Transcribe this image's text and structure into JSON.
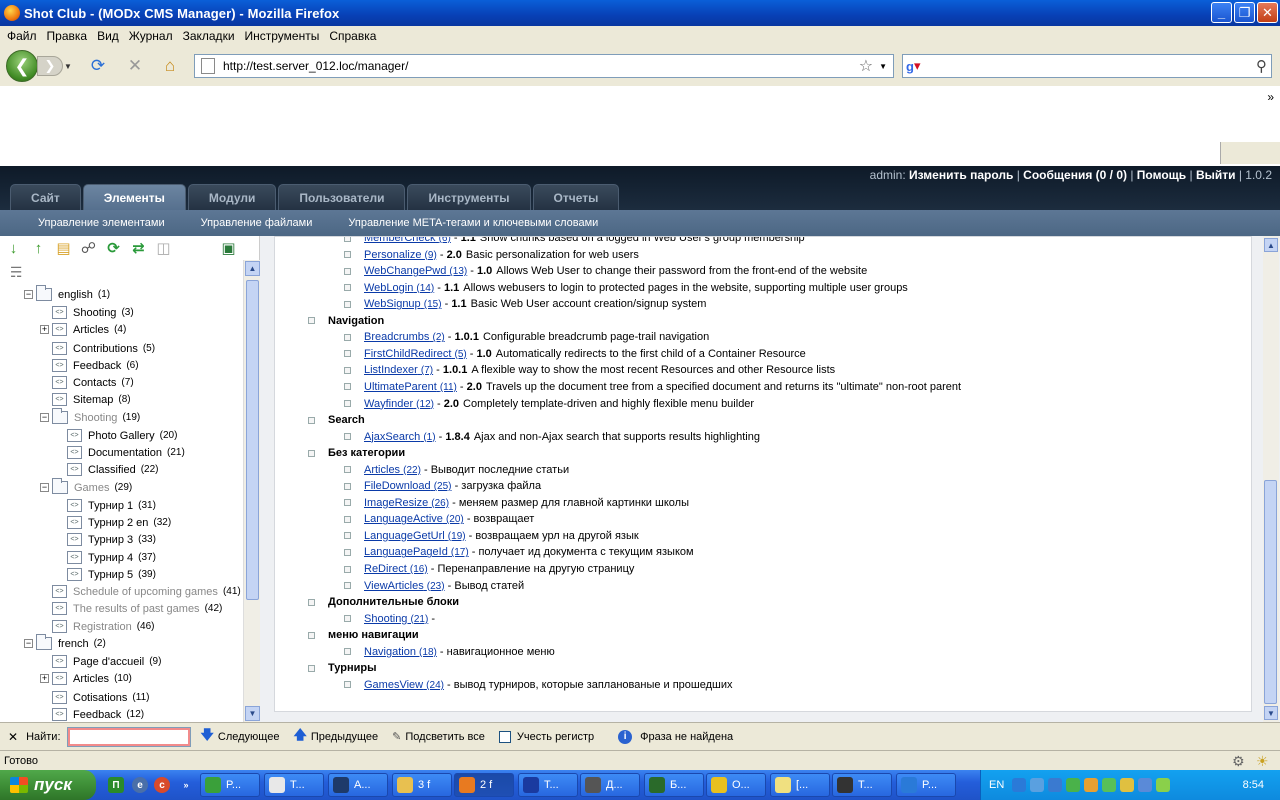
{
  "window": {
    "title": "Shot Club - (MODx CMS Manager) - Mozilla Firefox",
    "controls": [
      "_",
      "❐",
      "✕"
    ]
  },
  "menu": [
    "Файл",
    "Правка",
    "Вид",
    "Журнал",
    "Закладки",
    "Инструменты",
    "Справка"
  ],
  "nav": {
    "url": "http://test.server_012.loc/manager/",
    "search_value": ""
  },
  "modx": {
    "user_prefix": "admin:",
    "links": [
      "Изменить пароль",
      "Сообщения (0 / 0)",
      "Помощь",
      "Выйти"
    ],
    "version": "1.0.2",
    "tabs": [
      "Сайт",
      "Элементы",
      "Модули",
      "Пользователи",
      "Инструменты",
      "Отчеты"
    ],
    "active_tab": "Элементы",
    "subnav": [
      "Управление элементами",
      "Управление файлами",
      "Управление META-тегами и ключевыми словами"
    ]
  },
  "tree": [
    {
      "label": "english",
      "count": "(1)",
      "level": 0,
      "toggle": "−",
      "folder": true,
      "grey": false
    },
    {
      "label": "Shooting",
      "count": "(3)",
      "level": 1,
      "toggle": "",
      "folder": false,
      "grey": false
    },
    {
      "label": "Articles",
      "count": "(4)",
      "level": 1,
      "toggle": "+",
      "folder": false,
      "grey": false
    },
    {
      "label": "Contributions",
      "count": "(5)",
      "level": 1,
      "toggle": "",
      "folder": false,
      "grey": false
    },
    {
      "label": "Feedback",
      "count": "(6)",
      "level": 1,
      "toggle": "",
      "folder": false,
      "grey": false
    },
    {
      "label": "Contacts",
      "count": "(7)",
      "level": 1,
      "toggle": "",
      "folder": false,
      "grey": false
    },
    {
      "label": "Sitemap",
      "count": "(8)",
      "level": 1,
      "toggle": "",
      "folder": false,
      "grey": false
    },
    {
      "label": "Shooting",
      "count": "(19)",
      "level": 1,
      "toggle": "−",
      "folder": true,
      "grey": true
    },
    {
      "label": "Photo Gallery",
      "count": "(20)",
      "level": 2,
      "toggle": "",
      "folder": false,
      "grey": false
    },
    {
      "label": "Documentation",
      "count": "(21)",
      "level": 2,
      "toggle": "",
      "folder": false,
      "grey": false
    },
    {
      "label": "Classified",
      "count": "(22)",
      "level": 2,
      "toggle": "",
      "folder": false,
      "grey": false
    },
    {
      "label": "Games",
      "count": "(29)",
      "level": 1,
      "toggle": "−",
      "folder": true,
      "grey": true
    },
    {
      "label": "Турнир 1",
      "count": "(31)",
      "level": 2,
      "toggle": "",
      "folder": false,
      "grey": false
    },
    {
      "label": "Турнир 2 en",
      "count": "(32)",
      "level": 2,
      "toggle": "",
      "folder": false,
      "grey": false
    },
    {
      "label": "Турнир 3",
      "count": "(33)",
      "level": 2,
      "toggle": "",
      "folder": false,
      "grey": false
    },
    {
      "label": "Турнир 4",
      "count": "(37)",
      "level": 2,
      "toggle": "",
      "folder": false,
      "grey": false
    },
    {
      "label": "Турнир 5",
      "count": "(39)",
      "level": 2,
      "toggle": "",
      "folder": false,
      "grey": false
    },
    {
      "label": "Schedule of upcoming games",
      "count": "(41)",
      "level": 1,
      "toggle": "",
      "folder": false,
      "grey": true
    },
    {
      "label": "The results of past games",
      "count": "(42)",
      "level": 1,
      "toggle": "",
      "folder": false,
      "grey": true
    },
    {
      "label": "Registration",
      "count": "(46)",
      "level": 1,
      "toggle": "",
      "folder": false,
      "grey": true
    },
    {
      "label": "french",
      "count": "(2)",
      "level": 0,
      "toggle": "−",
      "folder": true,
      "grey": false
    },
    {
      "label": "Page d'accueil",
      "count": "(9)",
      "level": 1,
      "toggle": "",
      "folder": false,
      "grey": false
    },
    {
      "label": "Articles",
      "count": "(10)",
      "level": 1,
      "toggle": "+",
      "folder": false,
      "grey": false
    },
    {
      "label": "Cotisations",
      "count": "(11)",
      "level": 1,
      "toggle": "",
      "folder": false,
      "grey": false
    },
    {
      "label": "Feedback",
      "count": "(12)",
      "level": 1,
      "toggle": "",
      "folder": false,
      "grey": false
    }
  ],
  "content": [
    {
      "type": "item",
      "name": "MemberCheck",
      "id": "(6)",
      "ver": "1.1",
      "desc": "Show chunks based on a logged in Web User's group membership"
    },
    {
      "type": "item",
      "name": "Personalize",
      "id": "(9)",
      "ver": "2.0",
      "desc": "Basic personalization for web users"
    },
    {
      "type": "item",
      "name": "WebChangePwd",
      "id": "(13)",
      "ver": "1.0",
      "desc": "Allows Web User to change their password from the front-end of the website"
    },
    {
      "type": "item",
      "name": "WebLogin",
      "id": "(14)",
      "ver": "1.1",
      "desc": "Allows webusers to login to protected pages in the website, supporting multiple user groups"
    },
    {
      "type": "item",
      "name": "WebSignup",
      "id": "(15)",
      "ver": "1.1",
      "desc": "Basic Web User account creation/signup system"
    },
    {
      "type": "cat",
      "name": "Navigation"
    },
    {
      "type": "item",
      "name": "Breadcrumbs",
      "id": "(2)",
      "ver": "1.0.1",
      "desc": "Configurable breadcrumb page-trail navigation"
    },
    {
      "type": "item",
      "name": "FirstChildRedirect",
      "id": "(5)",
      "ver": "1.0",
      "desc": "Automatically redirects to the first child of a Container Resource"
    },
    {
      "type": "item",
      "name": "ListIndexer",
      "id": "(7)",
      "ver": "1.0.1",
      "desc": "A flexible way to show the most recent Resources and other Resource lists"
    },
    {
      "type": "item",
      "name": "UltimateParent",
      "id": "(11)",
      "ver": "2.0",
      "desc": "Travels up the document tree from a specified document and returns its \"ultimate\" non-root parent"
    },
    {
      "type": "item",
      "name": "Wayfinder",
      "id": "(12)",
      "ver": "2.0",
      "desc": "Completely template-driven and highly flexible menu builder"
    },
    {
      "type": "cat",
      "name": "Search"
    },
    {
      "type": "item",
      "name": "AjaxSearch",
      "id": "(1)",
      "ver": "1.8.4",
      "desc": "Ajax and non-Ajax search that supports results highlighting"
    },
    {
      "type": "cat",
      "name": "Без категории"
    },
    {
      "type": "item",
      "name": "Articles",
      "id": "(22)",
      "ver": "",
      "desc": "Выводит последние статьи"
    },
    {
      "type": "item",
      "name": "FileDownload",
      "id": "(25)",
      "ver": "",
      "desc": "загрузка файла"
    },
    {
      "type": "item",
      "name": "ImageResize",
      "id": "(26)",
      "ver": "",
      "desc": "меняем размер для главной картинки школы"
    },
    {
      "type": "item",
      "name": "LanguageActive",
      "id": "(20)",
      "ver": "",
      "desc": "возвращает"
    },
    {
      "type": "item",
      "name": "LanguageGetUrl",
      "id": "(19)",
      "ver": "",
      "desc": "возвращаем урл на другой язык"
    },
    {
      "type": "item",
      "name": "LanguagePageId",
      "id": "(17)",
      "ver": "",
      "desc": "получает ид документа с текущим языком"
    },
    {
      "type": "item",
      "name": "ReDirect",
      "id": "(16)",
      "ver": "",
      "desc": "Перенаправление на другую страницу"
    },
    {
      "type": "item",
      "name": "ViewArticles",
      "id": "(23)",
      "ver": "",
      "desc": "Вывод статей"
    },
    {
      "type": "cat",
      "name": "Дополнительные блоки"
    },
    {
      "type": "item",
      "name": "Shooting",
      "id": "(21)",
      "ver": "",
      "desc": ""
    },
    {
      "type": "cat",
      "name": "меню навигации"
    },
    {
      "type": "item",
      "name": "Navigation",
      "id": "(18)",
      "ver": "",
      "desc": "навигационное меню"
    },
    {
      "type": "cat",
      "name": "Турниры"
    },
    {
      "type": "item",
      "name": "GamesView",
      "id": "(24)",
      "ver": "",
      "desc": "вывод турниров, которые запланованые и прошедших"
    }
  ],
  "findbar": {
    "label": "Найти:",
    "value": "",
    "next": "Следующее",
    "prev": "Предыдущее",
    "highlight": "Подсветить все",
    "case": "Учесть регистр",
    "status": "Фраза не найдена"
  },
  "status": "Готово",
  "taskbar": {
    "start": "пуск",
    "tasks": [
      "P...",
      "T...",
      "A...",
      "3 f",
      "2 f",
      "T...",
      "Д...",
      "Б...",
      "O...",
      "[...",
      "T...",
      "P..."
    ],
    "lang": "EN",
    "time": "8:54"
  }
}
